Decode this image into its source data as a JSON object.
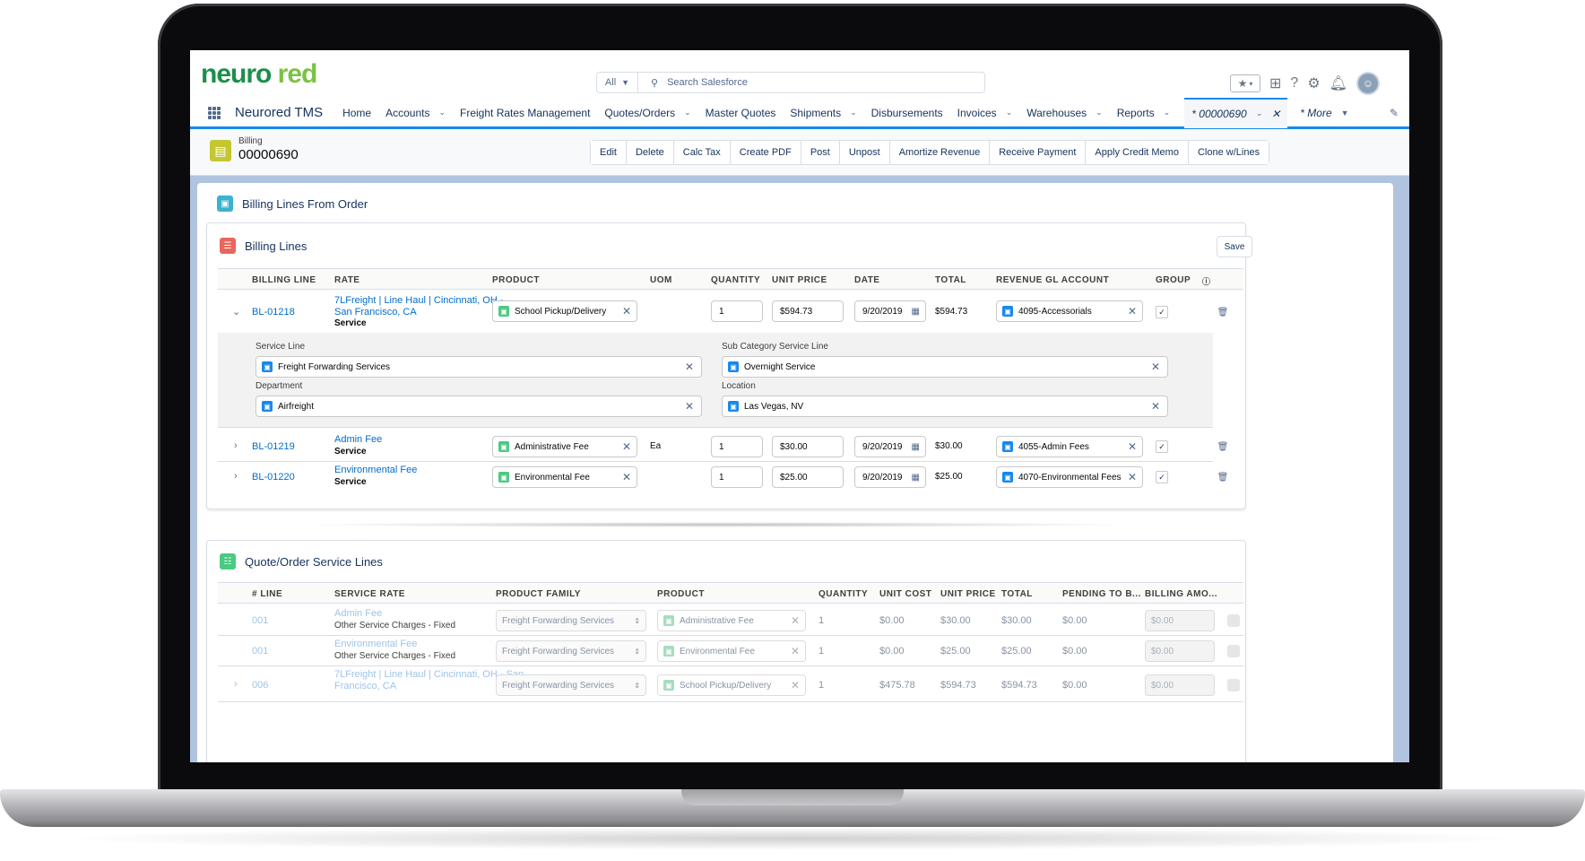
{
  "header": {
    "logo_part1": "neuro",
    "logo_part2": " red",
    "search_scope": "All",
    "search_placeholder": "Search Salesforce"
  },
  "nav": {
    "app_name": "Neurored TMS",
    "items": [
      {
        "label": "Home",
        "dropdown": false
      },
      {
        "label": "Accounts",
        "dropdown": true
      },
      {
        "label": "Freight Rates Management",
        "dropdown": false
      },
      {
        "label": "Quotes/Orders",
        "dropdown": true
      },
      {
        "label": "Master Quotes",
        "dropdown": false
      },
      {
        "label": "Shipments",
        "dropdown": true
      },
      {
        "label": "Disbursements",
        "dropdown": false
      },
      {
        "label": "Invoices",
        "dropdown": true
      },
      {
        "label": "Warehouses",
        "dropdown": true
      },
      {
        "label": "Reports",
        "dropdown": true
      }
    ],
    "active_tab": "* 00000690",
    "more": "* More"
  },
  "record": {
    "object": "Billing",
    "name": "00000690",
    "actions": [
      "Edit",
      "Delete",
      "Calc Tax",
      "Create PDF",
      "Post",
      "Unpost",
      "Amortize Revenue",
      "Receive Payment",
      "Apply Credit Memo",
      "Clone w/Lines"
    ]
  },
  "main_section": {
    "title": "Billing Lines From Order"
  },
  "billing_lines": {
    "title": "Billing Lines",
    "save_label": "Save",
    "columns": [
      "BILLING LINE",
      "RATE",
      "PRODUCT",
      "UOM",
      "QUANTITY",
      "UNIT PRICE",
      "DATE",
      "TOTAL",
      "REVENUE GL ACCOUNT",
      "GROUP"
    ],
    "rows": [
      {
        "id": "BL-01218",
        "rate_line1": "7LFreight | Line Haul | Cincinnati, OH -",
        "rate_line2": "San Francisco, CA",
        "rate_type": "Service",
        "product": "School Pickup/Delivery",
        "uom": "",
        "quantity": "1",
        "unit_price": "$594.73",
        "date": "9/20/2019",
        "total": "$594.73",
        "gl_account": "4095-Accessorials",
        "group_checked": true,
        "expanded": true
      },
      {
        "id": "BL-01219",
        "rate_line1": "Admin Fee",
        "rate_line2": "",
        "rate_type": "Service",
        "product": "Administrative Fee",
        "uom": "Ea",
        "quantity": "1",
        "unit_price": "$30.00",
        "date": "9/20/2019",
        "total": "$30.00",
        "gl_account": "4055-Admin Fees",
        "group_checked": true,
        "expanded": false
      },
      {
        "id": "BL-01220",
        "rate_line1": "Environmental Fee",
        "rate_line2": "",
        "rate_type": "Service",
        "product": "Environmental Fee",
        "uom": "",
        "quantity": "1",
        "unit_price": "$25.00",
        "date": "9/20/2019",
        "total": "$25.00",
        "gl_account": "4070-Environmental Fees",
        "group_checked": true,
        "expanded": false
      }
    ],
    "detail": {
      "service_line_label": "Service Line",
      "service_line": "Freight Forwarding Services",
      "sub_category_label": "Sub Category Service Line",
      "sub_category": "Overnight Service",
      "department_label": "Department",
      "department": "Airfreight",
      "location_label": "Location",
      "location": "Las Vegas, NV"
    }
  },
  "service_lines": {
    "title": "Quote/Order Service Lines",
    "columns": [
      "# LINE",
      "SERVICE RATE",
      "PRODUCT FAMILY",
      "PRODUCT",
      "QUANTITY",
      "UNIT COST",
      "UNIT PRICE",
      "TOTAL",
      "PENDING TO B...",
      "BILLING AMO..."
    ],
    "rows": [
      {
        "line": "001",
        "rate_line1": "Admin Fee",
        "rate_line2": "Other Service Charges - Fixed",
        "family": "Freight Forwarding Services",
        "product": "Administrative Fee",
        "quantity": "1",
        "unit_cost": "$0.00",
        "unit_price": "$30.00",
        "total": "$30.00",
        "pending": "$0.00",
        "billing_amount": "$0.00"
      },
      {
        "line": "001",
        "rate_line1": "Environmental Fee",
        "rate_line2": "Other Service Charges - Fixed",
        "family": "Freight Forwarding Services",
        "product": "Environmental Fee",
        "quantity": "1",
        "unit_cost": "$0.00",
        "unit_price": "$25.00",
        "total": "$25.00",
        "pending": "$0.00",
        "billing_amount": "$0.00"
      },
      {
        "line": "006",
        "rate_line1": "7LFreight | Line Haul | Cincinnati, OH - San",
        "rate_line2": "Francisco, CA",
        "family": "Freight Forwarding Services",
        "product": "School Pickup/Delivery",
        "quantity": "1",
        "unit_cost": "$475.78",
        "unit_price": "$594.73",
        "total": "$594.73",
        "pending": "$0.00",
        "billing_amount": "$0.00"
      }
    ]
  },
  "icons": {
    "search": "search-icon",
    "favorites": "star-icon",
    "add": "plus-icon",
    "help": "question-icon",
    "setup": "gear-icon",
    "notifications": "bell-icon",
    "calendar": "calendar-icon",
    "delete": "trash-icon",
    "clear": "close-icon"
  },
  "colors": {
    "brand_dark": "#1b8f4a",
    "brand_light": "#7cc242",
    "accent": "#1589ee",
    "link": "#006dcc",
    "record_icon": "#c5c730"
  }
}
